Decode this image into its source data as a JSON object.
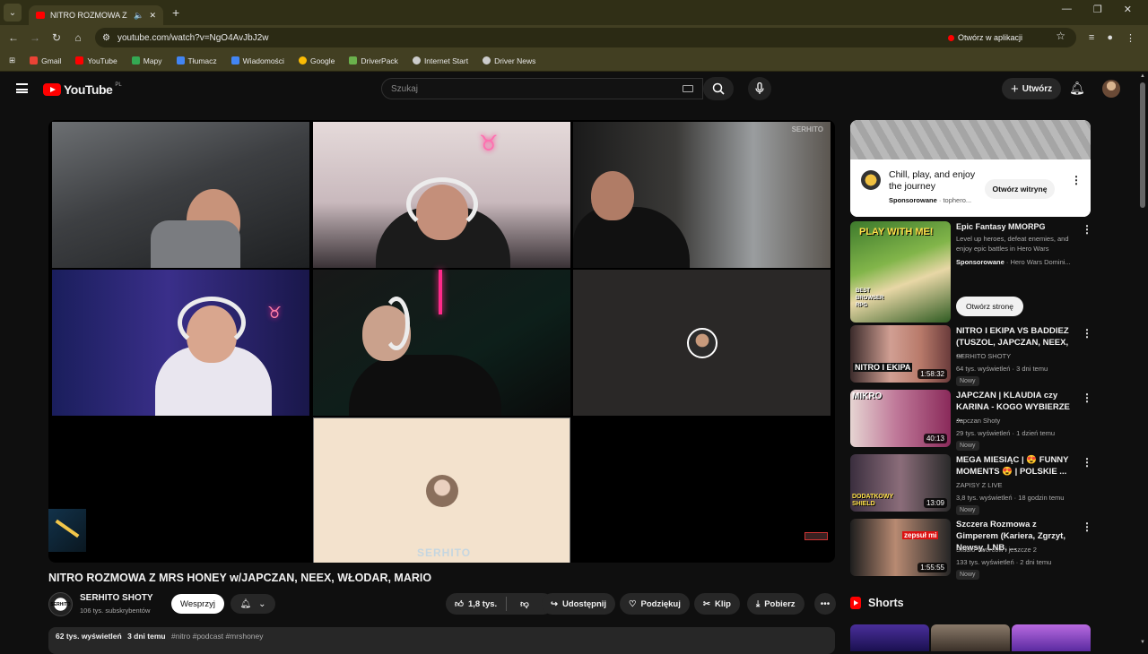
{
  "browser": {
    "tab_title": "NITRO ROZMOWA Z MRS H",
    "url": "youtube.com/watch?v=NgO4AvJbJ2w",
    "open_in_app": "Otwórz w aplikacji",
    "bookmarks": [
      {
        "label": "Gmail",
        "color": "#ea4335"
      },
      {
        "label": "YouTube",
        "color": "#ff0000"
      },
      {
        "label": "Mapy",
        "color": "#34a853"
      },
      {
        "label": "Tłumacz",
        "color": "#4285f4"
      },
      {
        "label": "Wiadomości",
        "color": "#4285f4"
      },
      {
        "label": "Google",
        "color": "#fbbc05"
      },
      {
        "label": "DriverPack",
        "color": "#6ab04c"
      },
      {
        "label": "Internet Start",
        "color": "#cccccc"
      },
      {
        "label": "Driver News",
        "color": "#cccccc"
      }
    ]
  },
  "header": {
    "logo": "YouTube",
    "logo_country": "PL",
    "search_placeholder": "Szukaj",
    "create_label": "Utwórz"
  },
  "player": {
    "watermark": "SERHITO"
  },
  "video": {
    "title": "NITRO ROZMOWA Z MRS HONEY w/JAPCZAN, NEEX, WŁODAR, MARIO",
    "channel_name": "SERHITO SHOTY",
    "channel_subs": "106 tys. subskrybentów",
    "channel_avatar_text": "SERHITO",
    "support_label": "Wesprzyj",
    "likes": "1,8 tys.",
    "share_label": "Udostępnij",
    "thanks_label": "Podziękuj",
    "clip_label": "Klip",
    "download_label": "Pobierz",
    "views": "62 tys. wyświetleń",
    "uploaded": "3 dni temu",
    "tags": "#nitro #podcast #mrshoney"
  },
  "ad": {
    "title": "Chill, play, and enjoy the journey",
    "sponsored": "Sponsorowane",
    "domain": "tophero...",
    "button": "Otwórz witrynę"
  },
  "ad2": {
    "title": "Epic Fantasy MMORPG",
    "description": "Level up heroes, defeat enemies, and enjoy epic battles in Hero Wars",
    "sponsored": "Sponsorowane",
    "advertiser": "· Hero Wars Domini...",
    "button": "Otwórz stronę",
    "thumb_text": "PLAY WITH ME!",
    "thumb_sub": "BEST BROWSER RPG"
  },
  "recommendations": [
    {
      "title": "NITRO I EKIPA VS BADDIEZ (TUSZOL, JAPCZAN, NEEX, ...",
      "channel": "SERHITO SHOTY",
      "meta": "64 tys. wyświetleń · 3 dni temu",
      "badge": "Nowy",
      "duration": "1:58:32"
    },
    {
      "title": "JAPCZAN | KLAUDIA czy KARINA - KOGO WYBIERZE ...",
      "channel": "Japczan Shoty",
      "meta": "29 tys. wyświetleń · 1 dzień temu",
      "badge": "Nowy",
      "duration": "40:13"
    },
    {
      "title": "MEGA MIESIĄC | 😍 FUNNY MOMENTS 😍 | POLSKIE ...",
      "channel": "ZAPISY Z LIVE",
      "meta": "3,8 tys. wyświetleń · 18 godzin temu",
      "badge": "Nowy",
      "duration": "13:09"
    },
    {
      "title": "Szczera Rozmowa z Gimperem (Kariera, Zgrzyt, Newsy, LNB, ...",
      "channel": "Studio Twórców i jeszcze 2",
      "meta": "133 tys. wyświetleń · 2 dni temu",
      "badge": "Nowy",
      "duration": "1:55:55"
    }
  ],
  "shorts": {
    "label": "Shorts"
  }
}
